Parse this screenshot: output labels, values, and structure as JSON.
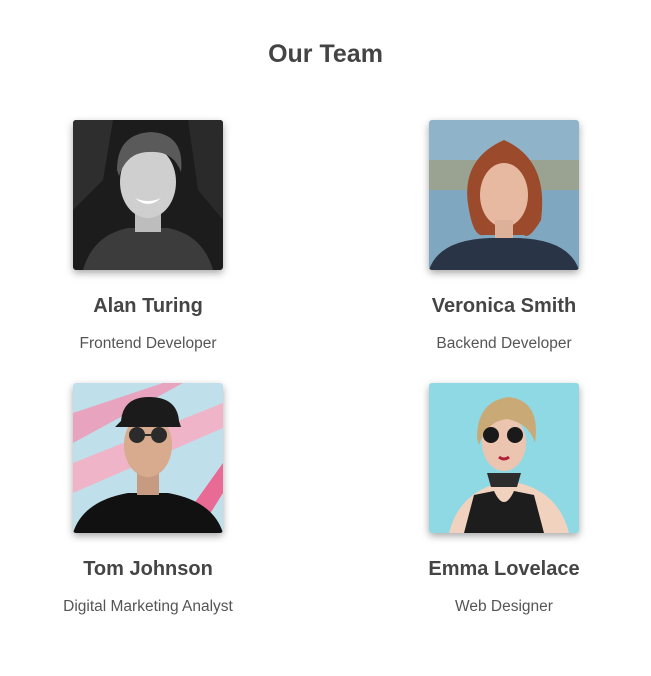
{
  "page": {
    "title": "Our Team"
  },
  "team": [
    {
      "name": "Alan Turing",
      "role": "Frontend Developer"
    },
    {
      "name": "Veronica Smith",
      "role": "Backend Developer"
    },
    {
      "name": "Tom Johnson",
      "role": "Digital Marketing Analyst"
    },
    {
      "name": "Emma Lovelace",
      "role": "Web Designer"
    }
  ]
}
